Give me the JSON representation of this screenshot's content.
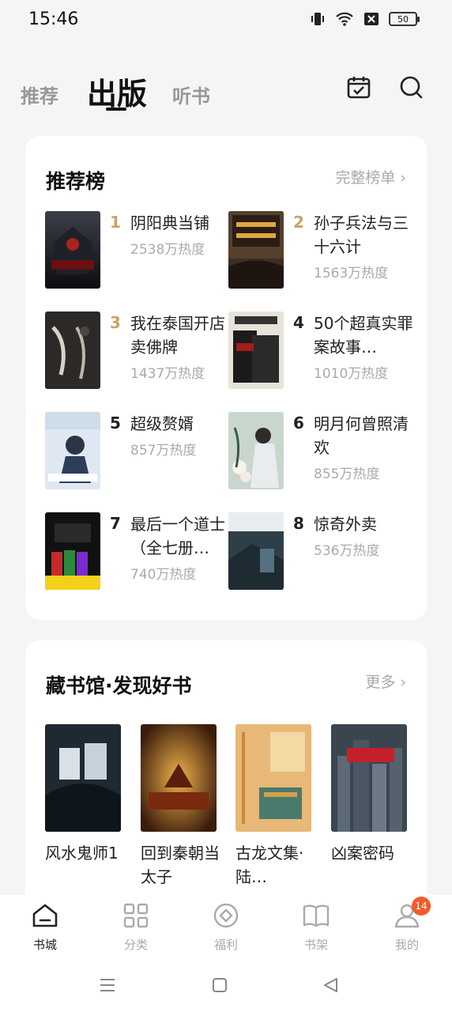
{
  "status_bar": {
    "time": "15:46",
    "battery": "50"
  },
  "top_tabs": [
    {
      "label": "推荐"
    },
    {
      "label": "出版"
    },
    {
      "label": "听书"
    }
  ],
  "ranking": {
    "title": "推荐榜",
    "more": "完整榜单 ›",
    "items": [
      {
        "rank": "1",
        "name": "阴阳典当铺",
        "heat": "2538万热度"
      },
      {
        "rank": "2",
        "name": "孙子兵法与三十六计",
        "heat": "1563万热度"
      },
      {
        "rank": "3",
        "name": "我在泰国开店卖佛牌",
        "heat": "1437万热度"
      },
      {
        "rank": "4",
        "name": "50个超真实罪案故事…",
        "heat": "1010万热度"
      },
      {
        "rank": "5",
        "name": "超级赘婿",
        "heat": "857万热度"
      },
      {
        "rank": "6",
        "name": "明月何曾照清欢",
        "heat": "855万热度"
      },
      {
        "rank": "7",
        "name": "最后一个道士（全七册…",
        "heat": "740万热度"
      },
      {
        "rank": "8",
        "name": "惊奇外卖",
        "heat": "536万热度"
      }
    ]
  },
  "library": {
    "title": "藏书馆·发现好书",
    "more": "更多 ›",
    "items": [
      {
        "name": "风水鬼师1"
      },
      {
        "name": "回到秦朝当太子"
      },
      {
        "name": "古龙文集·陆…"
      },
      {
        "name": "凶案密码"
      }
    ]
  },
  "bottom_nav": [
    {
      "label": "书城"
    },
    {
      "label": "分类"
    },
    {
      "label": "福利"
    },
    {
      "label": "书架"
    },
    {
      "label": "我的",
      "badge": "14"
    }
  ]
}
